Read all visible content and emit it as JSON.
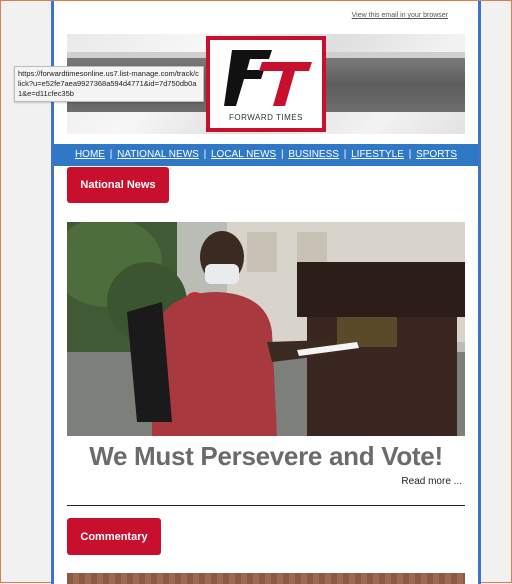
{
  "email": {
    "view_in_browser": "View this email in your browser",
    "logo": {
      "letters": "FT",
      "caption": "FORWARD TIMES"
    },
    "nav": [
      {
        "label": "HOME"
      },
      {
        "label": "NATIONAL NEWS"
      },
      {
        "label": "LOCAL NEWS"
      },
      {
        "label": "BUSINESS"
      },
      {
        "label": "LIFESTYLE"
      },
      {
        "label": "SPORTS"
      }
    ],
    "nav_separator": "|",
    "section1": {
      "label": "National News"
    },
    "article": {
      "headline": "We Must Persevere and Vote!",
      "read_more": "Read more ..."
    },
    "section2": {
      "label": "Commentary"
    }
  },
  "tooltip": {
    "url": "https://forwardtimesonline.us7.list-manage.com/track/click?u=e52fe7aea9927368a594d4771&id=7d750db0a1&e=d11cfec35b"
  },
  "colors": {
    "brand_red": "#c8102e",
    "nav_blue": "#2f78c6",
    "frame_blue": "#3d74c9"
  }
}
